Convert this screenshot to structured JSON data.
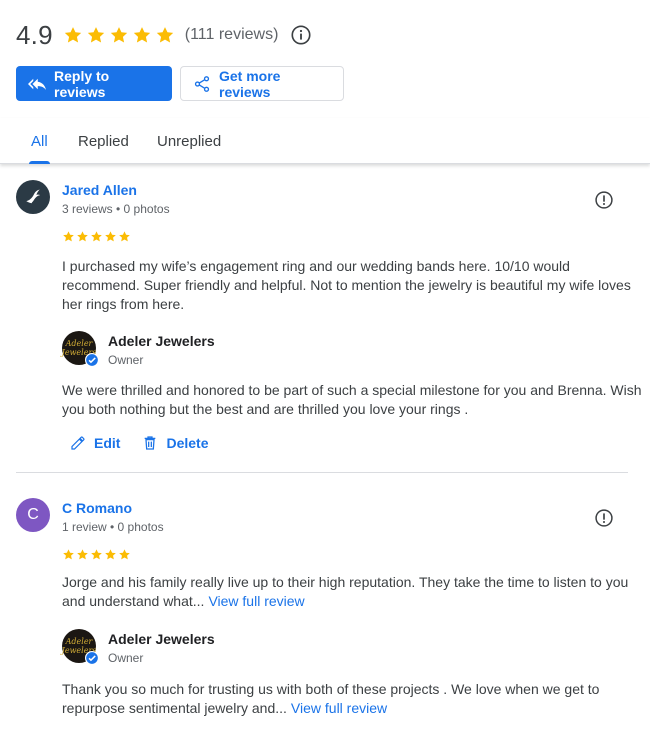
{
  "summary": {
    "rating": "4.9",
    "stars": 5,
    "review_count": "(111 reviews)",
    "info_icon": "info-icon"
  },
  "actions": {
    "reply_label": "Reply to reviews",
    "get_more_label": "Get more reviews"
  },
  "tabs": [
    {
      "label": "All",
      "active": true
    },
    {
      "label": "Replied",
      "active": false
    },
    {
      "label": "Unreplied",
      "active": false
    }
  ],
  "reviews": [
    {
      "name": "Jared Allen",
      "meta": "3 reviews • 0 photos",
      "stars": 5,
      "text": "I purchased my wife’s engagement ring and our wedding bands here. 10/10 would recommend. Super friendly and helpful. Not to mention the jewelry is beautiful my wife loves her rings from here.",
      "reply": {
        "owner_name": "Adeler Jewelers",
        "owner_role": "Owner",
        "owner_logo_text": "Adeler Jewelers",
        "text": "We were thrilled and honored to be part of such a special milestone for you and Brenna. Wish you both nothing but the best and are thrilled you love your rings ."
      },
      "edit_label": "Edit",
      "delete_label": "Delete"
    },
    {
      "name": "C Romano",
      "avatar_letter": "C",
      "meta": "1 review • 0 photos",
      "stars": 5,
      "text": "Jorge and his family really live up to their high reputation. They take the time to listen to you and understand what...",
      "view_full": "View full review",
      "reply": {
        "owner_name": "Adeler Jewelers",
        "owner_role": "Owner",
        "owner_logo_text": "Adeler Jewelers",
        "text": "Thank you so much for trusting us with both of these projects . We love when we get to repurpose sentimental jewelry and...",
        "view_full": "View full review"
      }
    }
  ],
  "colors": {
    "accent": "#1a73e8",
    "star": "#fbbc04",
    "avatar_purple": "#7e57c2"
  }
}
